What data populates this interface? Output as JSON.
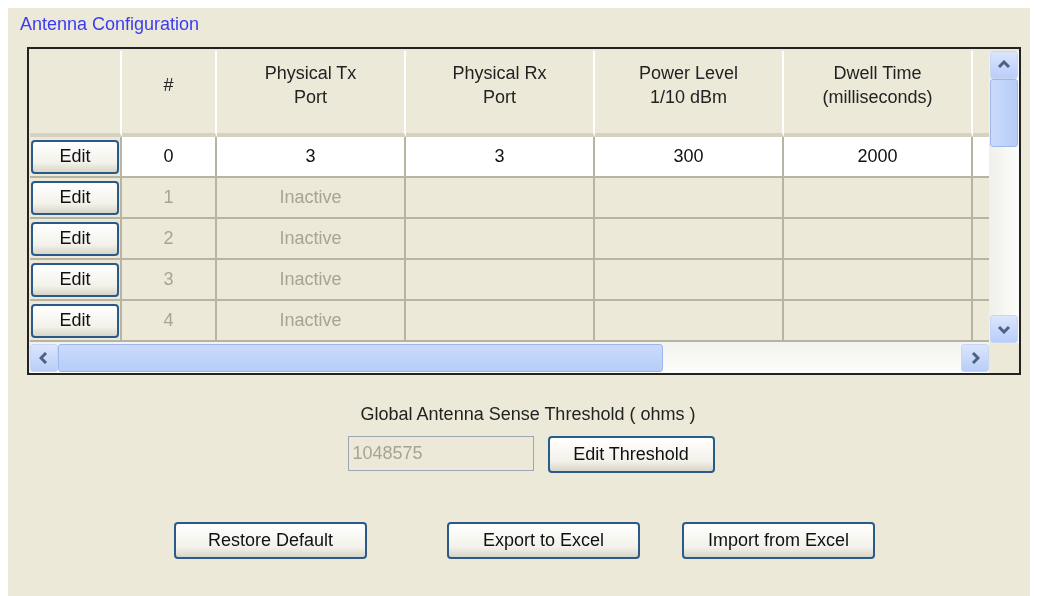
{
  "group_title": "Antenna Configuration",
  "table": {
    "columns": [
      "#",
      "Physical Tx\nPort",
      "Physical Rx\nPort",
      "Power Level\n1/10 dBm",
      "Dwell Time\n(milliseconds)"
    ],
    "rows": [
      {
        "button": "Edit",
        "number": "0",
        "tx_port": "3",
        "rx_port": "3",
        "power_level": "300",
        "dwell_time": "2000",
        "active": true
      },
      {
        "button": "Edit",
        "number": "1",
        "tx_port": "Inactive",
        "active": false
      },
      {
        "button": "Edit",
        "number": "2",
        "tx_port": "Inactive",
        "active": false
      },
      {
        "button": "Edit",
        "number": "3",
        "tx_port": "Inactive",
        "active": false
      },
      {
        "button": "Edit",
        "number": "4",
        "tx_port": "Inactive",
        "active": false
      }
    ]
  },
  "threshold": {
    "label": "Global Antenna Sense Threshold ( ohms )",
    "value": "1048575",
    "disabled": true,
    "button": "Edit Threshold"
  },
  "buttons": [
    "Restore Default",
    "Export to Excel",
    "Import from Excel"
  ]
}
